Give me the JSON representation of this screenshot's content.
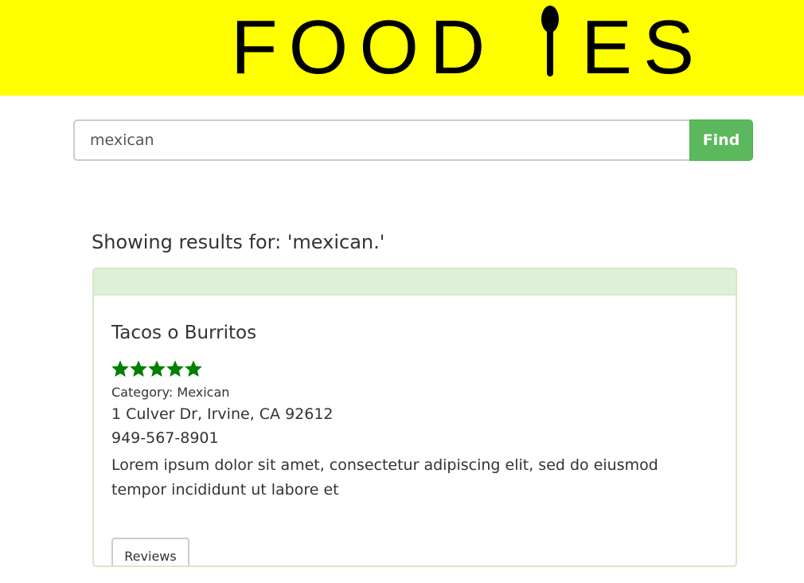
{
  "header": {
    "logo_text": "FOOD",
    "logo_text_end": "ES",
    "background_color": "#ffff00"
  },
  "search": {
    "value": "mexican",
    "button_label": "Find",
    "button_color": "#5cb85c"
  },
  "results": {
    "heading": "Showing results for: 'mexican.'",
    "items": [
      {
        "name": "Tacos o Burritos",
        "rating": 5,
        "rating_max": 5,
        "star_color": "#008000",
        "category": "Category: Mexican",
        "address": "1 Culver Dr, Irvine, CA 92612",
        "phone": "949-567-8901",
        "description": "Lorem ipsum dolor sit amet, consectetur adipiscing elit, sed do eiusmod tempor incididunt ut labore et",
        "reviews_label": "Reviews"
      }
    ]
  }
}
